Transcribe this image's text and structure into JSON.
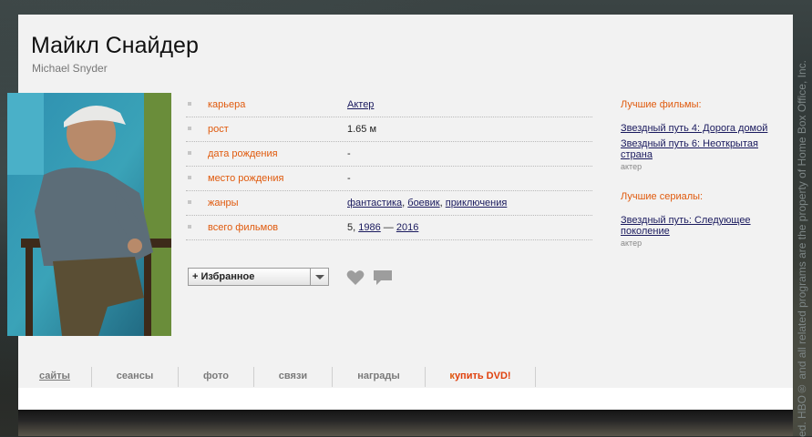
{
  "person": {
    "name_ru": "Майкл Снайдер",
    "name_en": "Michael Snyder"
  },
  "info": [
    {
      "label": "карьера",
      "value": "Актер",
      "link": true
    },
    {
      "label": "рост",
      "value": "1.65 м",
      "link": false
    },
    {
      "label": "дата рождения",
      "value": "-",
      "link": false
    },
    {
      "label": "место рождения",
      "value": "-",
      "link": false
    },
    {
      "label": "жанры",
      "links": [
        "фантастика",
        "боевик",
        "приключения"
      ]
    },
    {
      "label": "всего фильмов",
      "count": "5,",
      "year_from": "1986",
      "dash": "—",
      "year_to": "2016"
    }
  ],
  "favorites": {
    "label": "+ Избранное"
  },
  "best_films": {
    "title": "Лучшие фильмы:",
    "items": [
      {
        "title": "Звездный путь 4: Дорога домой",
        "role": ""
      },
      {
        "title": "Звездный путь 6: Неоткрытая страна",
        "role": "актер"
      }
    ]
  },
  "best_series": {
    "title": "Лучшие сериалы:",
    "items": [
      {
        "title": "Звездный путь: Следующее поколение",
        "role": "актер"
      }
    ]
  },
  "tabs": [
    "сайты",
    "сеансы",
    "фото",
    "связи",
    "награды"
  ],
  "tab_dvd": {
    "k": "к",
    "rest": "упить DVD!"
  },
  "side_text": "ed. HBO® and all related programs are the property of Home Box Office, Inc.",
  "colors": {
    "accent": "#e05a0d",
    "link": "#1a1a5e",
    "panel": "#f2f2f2"
  }
}
